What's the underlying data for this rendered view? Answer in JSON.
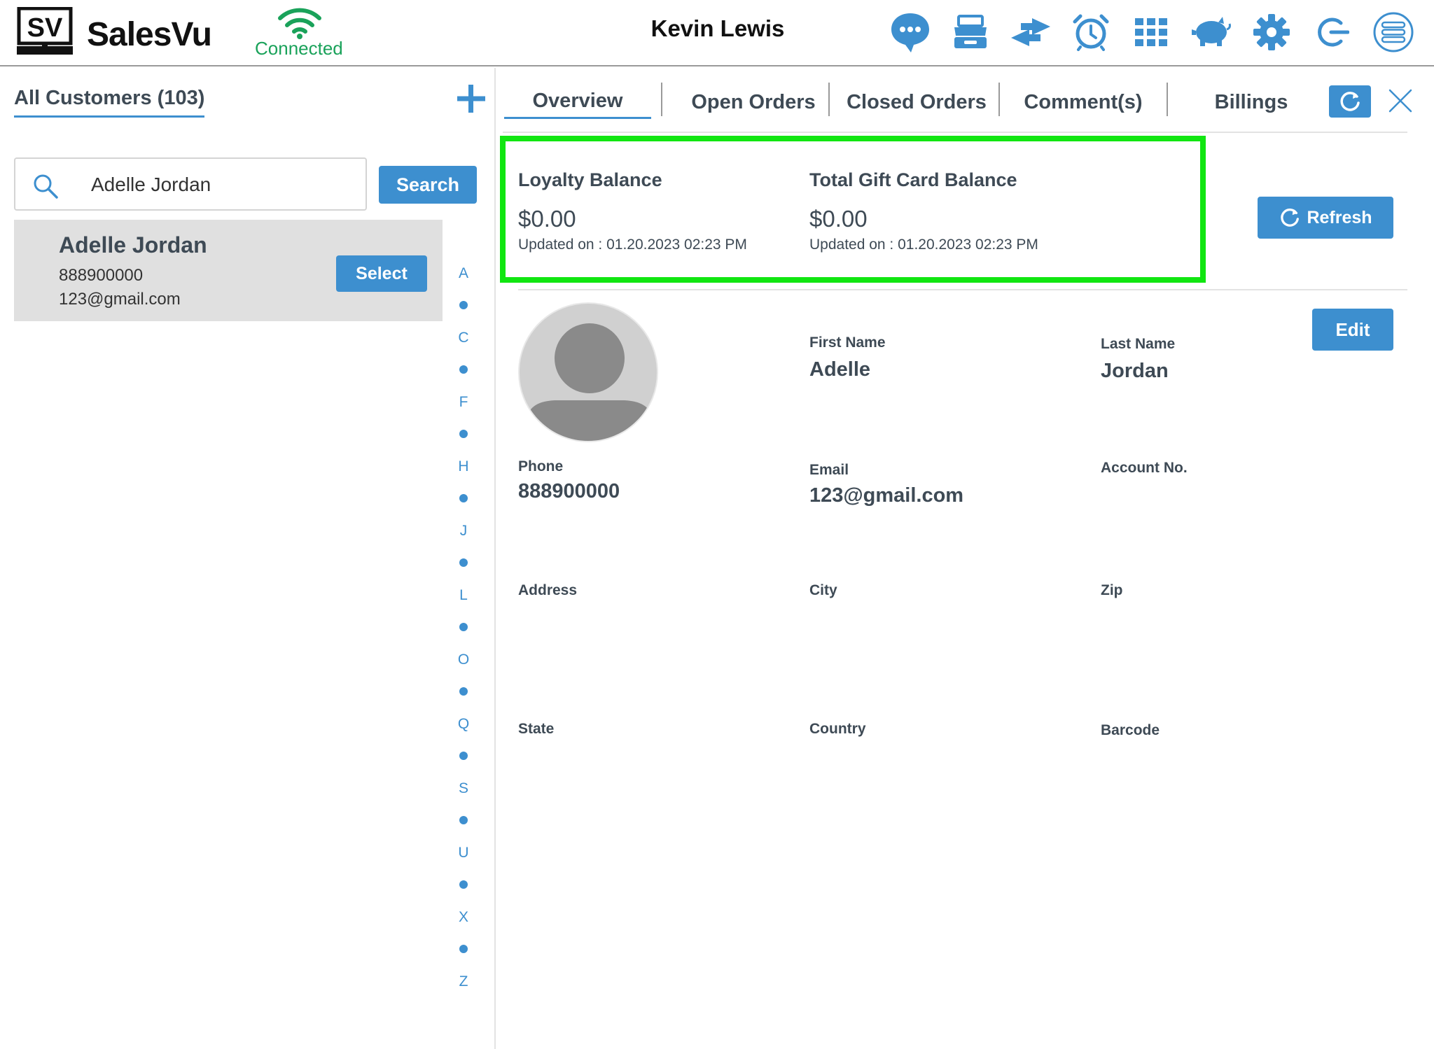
{
  "header": {
    "brand": "SalesVu",
    "logo_letters": "SV",
    "connection_status": "Connected",
    "user_name": "Kevin Lewis",
    "icons": [
      "chat-icon",
      "cash-drawer-icon",
      "transfer-icon",
      "alarm-clock-icon",
      "grid-icon",
      "piggy-bank-icon",
      "gear-icon",
      "logout-icon",
      "menu-list-icon"
    ]
  },
  "left": {
    "title": "All Customers (103)",
    "search": {
      "value": "Adelle Jordan",
      "button_label": "Search"
    },
    "customers": [
      {
        "name": "Adelle Jordan",
        "phone": "888900000",
        "email": "123@gmail.com",
        "select_label": "Select"
      }
    ],
    "alpha_index": [
      "A",
      "C",
      "F",
      "H",
      "J",
      "L",
      "O",
      "Q",
      "S",
      "U",
      "X",
      "Z"
    ]
  },
  "tabs": [
    {
      "label": "Overview",
      "active": true
    },
    {
      "label": "Open Orders",
      "active": false
    },
    {
      "label": "Closed Orders",
      "active": false
    },
    {
      "label": "Comment(s)",
      "active": false
    },
    {
      "label": "Billings",
      "active": false
    }
  ],
  "balances": {
    "loyalty": {
      "label": "Loyalty Balance",
      "value": "$0.00",
      "updated": "Updated on :  01.20.2023 02:23 PM"
    },
    "gift_card": {
      "label": "Total Gift Card Balance",
      "value": "$0.00",
      "updated": "Updated on :  01.20.2023 02:23 PM"
    },
    "refresh_label": "Refresh",
    "highlight_color": "#11e611"
  },
  "profile": {
    "edit_label": "Edit",
    "fields": {
      "first_name": {
        "label": "First Name",
        "value": "Adelle"
      },
      "last_name": {
        "label": "Last Name",
        "value": "Jordan"
      },
      "phone": {
        "label": "Phone",
        "value": "888900000"
      },
      "email": {
        "label": "Email",
        "value": "123@gmail.com"
      },
      "account_no": {
        "label": "Account No.",
        "value": ""
      },
      "address": {
        "label": "Address",
        "value": ""
      },
      "city": {
        "label": "City",
        "value": ""
      },
      "zip": {
        "label": "Zip",
        "value": ""
      },
      "state": {
        "label": "State",
        "value": ""
      },
      "country": {
        "label": "Country",
        "value": ""
      },
      "barcode": {
        "label": "Barcode",
        "value": ""
      }
    }
  },
  "colors": {
    "accent": "#3d8fcf",
    "connected": "#1aa25a",
    "text": "#3e4a55"
  }
}
